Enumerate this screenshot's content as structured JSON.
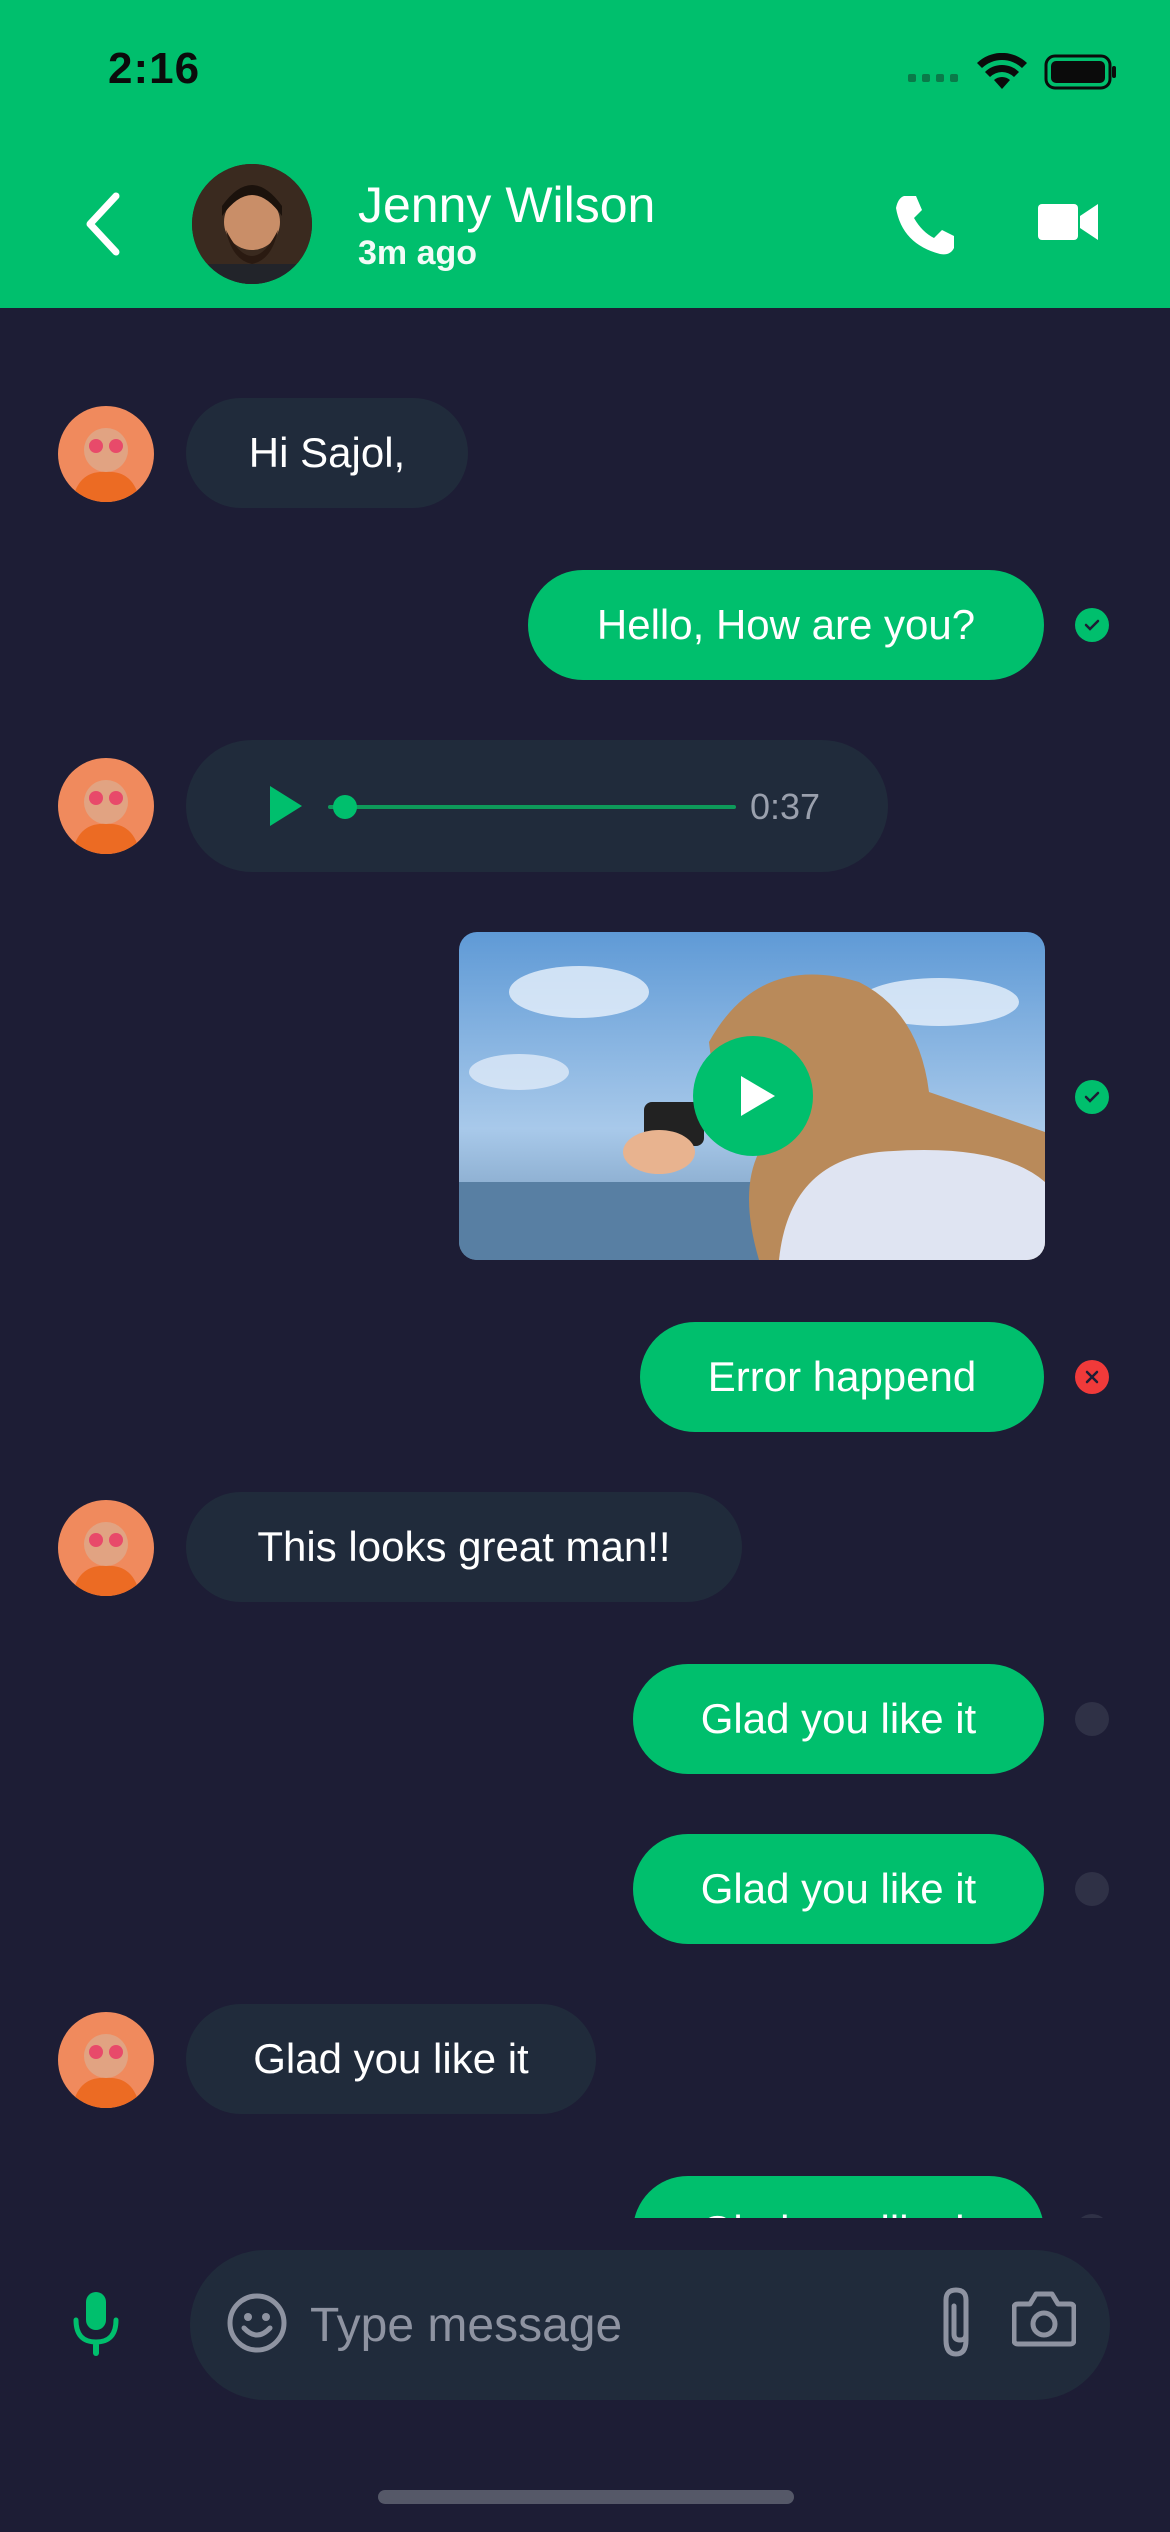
{
  "status_bar": {
    "time": "2:16"
  },
  "header": {
    "contact_name": "Jenny Wilson",
    "last_seen": "3m ago"
  },
  "messages": [
    {
      "type": "text",
      "direction": "incoming",
      "text": "Hi Sajol,"
    },
    {
      "type": "text",
      "direction": "outgoing",
      "text": "Hello, How are you?",
      "status": "sent"
    },
    {
      "type": "audio",
      "direction": "incoming",
      "duration": "0:37",
      "progress": 0.0
    },
    {
      "type": "video",
      "direction": "outgoing",
      "status": "sent"
    },
    {
      "type": "text",
      "direction": "outgoing",
      "text": "Error happend",
      "status": "error"
    },
    {
      "type": "text",
      "direction": "incoming",
      "text": "This looks great man!!"
    },
    {
      "type": "text",
      "direction": "outgoing",
      "text": "Glad you like it",
      "status": "pending"
    },
    {
      "type": "text",
      "direction": "outgoing",
      "text": "Glad you like it",
      "status": "pending"
    },
    {
      "type": "text",
      "direction": "incoming",
      "text": "Glad you like it"
    },
    {
      "type": "text",
      "direction": "outgoing",
      "text": "Glad you like it",
      "status": "pending"
    }
  ],
  "composer": {
    "placeholder": "Type message"
  },
  "colors": {
    "accent": "#00bf6d",
    "background": "#1d1d35",
    "incoming_bubble": "#202b3b",
    "error": "#f03a3a"
  },
  "icons": {
    "back": "chevron-left-icon",
    "call": "phone-icon",
    "video": "video-camera-icon",
    "mic": "microphone-icon",
    "emoji": "emoji-icon",
    "attach": "paperclip-icon",
    "camera": "camera-icon"
  }
}
